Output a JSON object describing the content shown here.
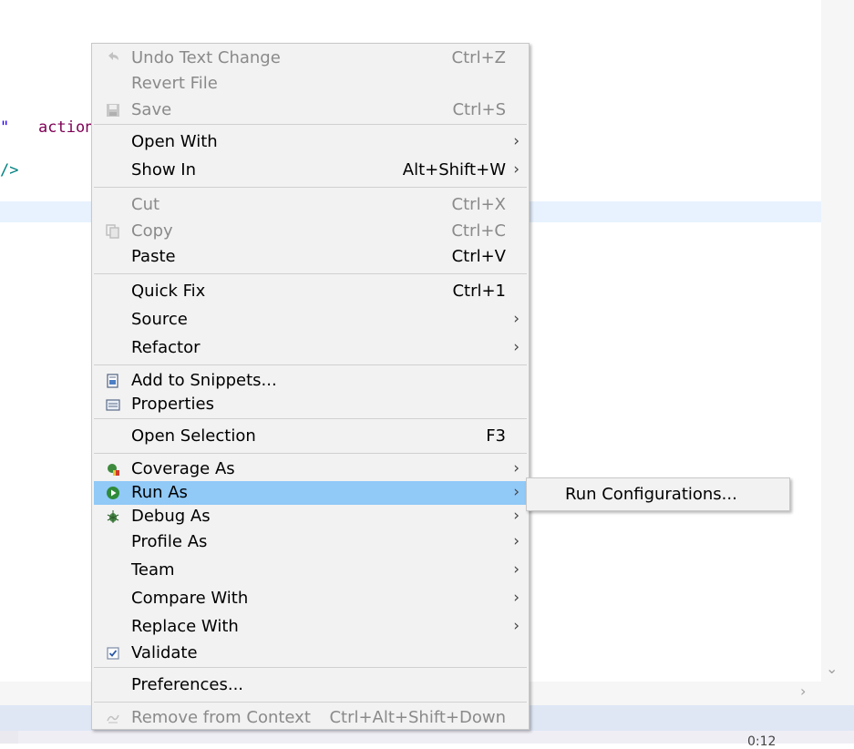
{
  "editor": {
    "code_quote": "\"",
    "code_action": "action",
    "code_tag_close": "/>"
  },
  "status": {
    "text": "0:12"
  },
  "menu": {
    "items": [
      {
        "label": "Undo Text Change",
        "shortcut": "Ctrl+Z",
        "disabled": true,
        "icon": "undo-icon"
      },
      {
        "label": "Revert File",
        "shortcut": "",
        "disabled": true
      },
      {
        "label": "Save",
        "shortcut": "Ctrl+S",
        "disabled": true,
        "icon": "save-icon"
      },
      {
        "label": "Open With",
        "submenu": true
      },
      {
        "label": "Show In",
        "shortcut": "Alt+Shift+W",
        "submenu": true
      },
      {
        "label": "Cut",
        "shortcut": "Ctrl+X",
        "disabled": true
      },
      {
        "label": "Copy",
        "shortcut": "Ctrl+C",
        "disabled": true,
        "icon": "copy-icon"
      },
      {
        "label": "Paste",
        "shortcut": "Ctrl+V"
      },
      {
        "label": "Quick Fix",
        "shortcut": "Ctrl+1"
      },
      {
        "label": "Source",
        "submenu": true
      },
      {
        "label": "Refactor",
        "submenu": true
      },
      {
        "label": "Add to Snippets...",
        "icon": "snippet-icon"
      },
      {
        "label": "Properties",
        "icon": "properties-icon"
      },
      {
        "label": "Open Selection",
        "shortcut": "F3"
      },
      {
        "label": "Coverage As",
        "submenu": true,
        "icon": "coverage-icon"
      },
      {
        "label": "Run As",
        "submenu": true,
        "active": true,
        "icon": "run-icon"
      },
      {
        "label": "Debug As",
        "submenu": true,
        "icon": "debug-bug-icon"
      },
      {
        "label": "Profile As",
        "submenu": true
      },
      {
        "label": "Team",
        "submenu": true
      },
      {
        "label": "Compare With",
        "submenu": true
      },
      {
        "label": "Replace With",
        "submenu": true
      },
      {
        "label": "Validate",
        "icon": "checkbox-checked-icon"
      },
      {
        "label": "Preferences..."
      },
      {
        "label": "Remove from Context",
        "shortcut": "Ctrl+Alt+Shift+Down",
        "disabled": true,
        "icon": "remove-context-icon"
      }
    ],
    "arrow_glyph": "›"
  },
  "submenu": {
    "items": [
      {
        "label": "Run Configurations..."
      }
    ]
  },
  "colors": {
    "menu_bg": "#f2f2f2",
    "active_bg": "#91c9f7",
    "disabled_text": "#8a8a8a",
    "code_purple": "#7f0055",
    "code_teal": "#008080"
  }
}
